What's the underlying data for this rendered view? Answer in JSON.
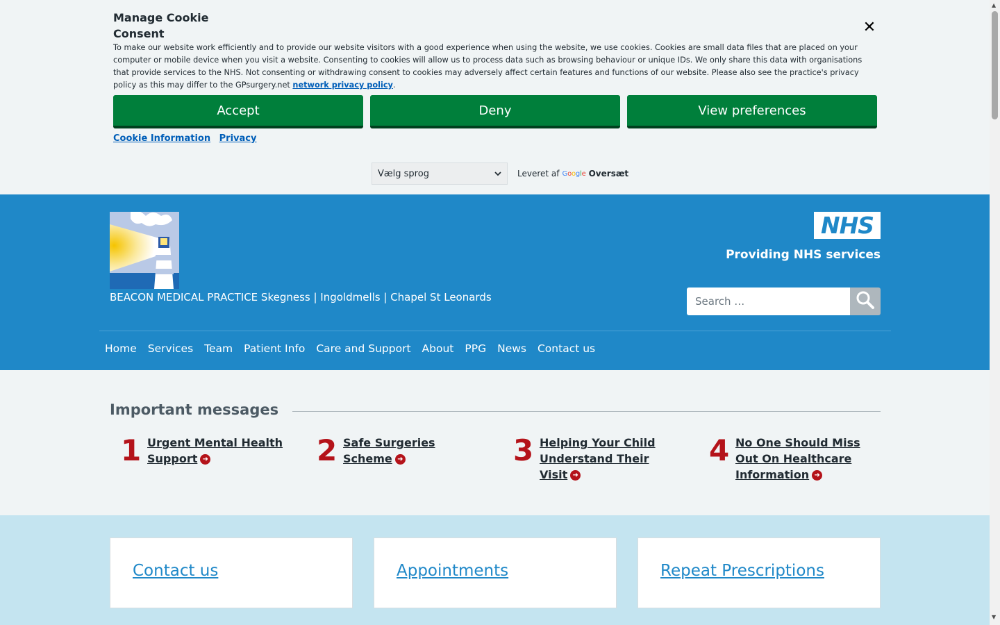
{
  "cookie": {
    "title": "Manage Cookie Consent",
    "close_icon": "✕",
    "text_main": "To make our website work efficiently and to provide our website visitors with a good experience when using the website, we use cookies. Cookies are small data files that are placed on your computer or mobile device when you visit a website. Consenting to cookies will allow us to process data such as browsing behaviour or unique IDs. We only share this data with organisations that provide services to the NHS. Not consenting or withdrawing consent to cookies may adversely affect certain features and functions of our website. Please also see the practice's privacy policy as this may differ to the GPsurgery.net ",
    "policy_link": "network privacy policy",
    "text_end": ".",
    "accept_label": "Accept",
    "deny_label": "Deny",
    "preferences_label": "View preferences",
    "cookie_info_link": "Cookie Information",
    "privacy_link": "Privacy"
  },
  "translate": {
    "select_value": "Vælg sprog",
    "powered_by": "Leveret af",
    "google": "Google",
    "translate_label": "Oversæt"
  },
  "header": {
    "practice_name": "BEACON MEDICAL PRACTICE Skegness | Ingoldmells | Chapel St Leonards",
    "nhs_logo": "NHS",
    "nhs_tagline": "Providing NHS services",
    "search_placeholder": "Search …"
  },
  "nav": {
    "items": [
      "Home",
      "Services",
      "Team",
      "Patient Info",
      "Care and Support",
      "About",
      "PPG",
      "News",
      "Contact us"
    ]
  },
  "messages": {
    "title": "Important messages",
    "items": [
      {
        "num": "1",
        "label": "Urgent Mental Health Support"
      },
      {
        "num": "2",
        "label": "Safe Surgeries Scheme"
      },
      {
        "num": "3",
        "label": "Helping Your Child Understand Their Visit"
      },
      {
        "num": "4",
        "label": "No One Should Miss Out On Healthcare Information"
      }
    ]
  },
  "cards": {
    "items": [
      "Contact us",
      "Appointments",
      "Repeat Prescriptions"
    ]
  },
  "colors": {
    "header_blue": "#1f88c8",
    "button_green": "#007f3b",
    "accent_red": "#b4131a",
    "link_blue": "#005eb8"
  }
}
